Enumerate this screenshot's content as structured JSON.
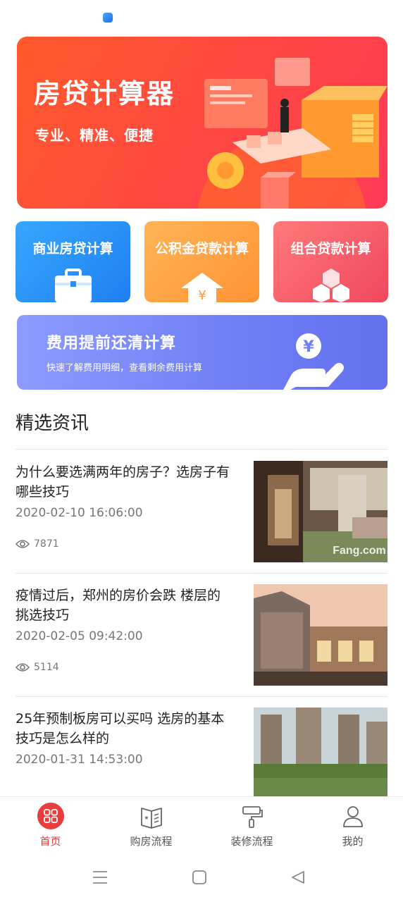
{
  "banner": {
    "title": "房贷计算器",
    "subtitle": "专业、精准、便捷"
  },
  "calculators": [
    {
      "label": "商业房贷计算",
      "icon": "briefcase-icon",
      "color": "#2a8ff5"
    },
    {
      "label": "公积金贷款计算",
      "icon": "house-yuan-icon",
      "color": "#ffa040"
    },
    {
      "label": "组合贷款计算",
      "icon": "cubes-icon",
      "color": "#f25a6a"
    }
  ],
  "prepay": {
    "title": "费用提前还清计算",
    "subtitle": "快速了解费用明细，查看剩余费用计算",
    "icon": "hand-coin-icon"
  },
  "news": {
    "section_title": "精选资讯",
    "items": [
      {
        "title": "为什么要选满两年的房子？选房子有哪些技巧",
        "time": "2020-02-10 16:06:00",
        "views": "7871",
        "thumb_watermark": "Fang.com"
      },
      {
        "title": "疫情过后，郑州的房价会跌 楼层的挑选技巧",
        "time": "2020-02-05 09:42:00",
        "views": "5114"
      },
      {
        "title": "25年预制板房可以买吗 选房的基本技巧是怎么样的",
        "time": "2020-01-31 14:53:00"
      }
    ]
  },
  "bottom_nav": [
    {
      "label": "首页",
      "icon": "home-grid-icon",
      "active": true
    },
    {
      "label": "购房流程",
      "icon": "book-icon",
      "active": false
    },
    {
      "label": "装修流程",
      "icon": "paint-roller-icon",
      "active": false
    },
    {
      "label": "我的",
      "icon": "user-icon",
      "active": false
    }
  ],
  "colors": {
    "accent": "#e83d3d",
    "banner": "#ff4a3e",
    "prepay": "#6f7ef5"
  }
}
